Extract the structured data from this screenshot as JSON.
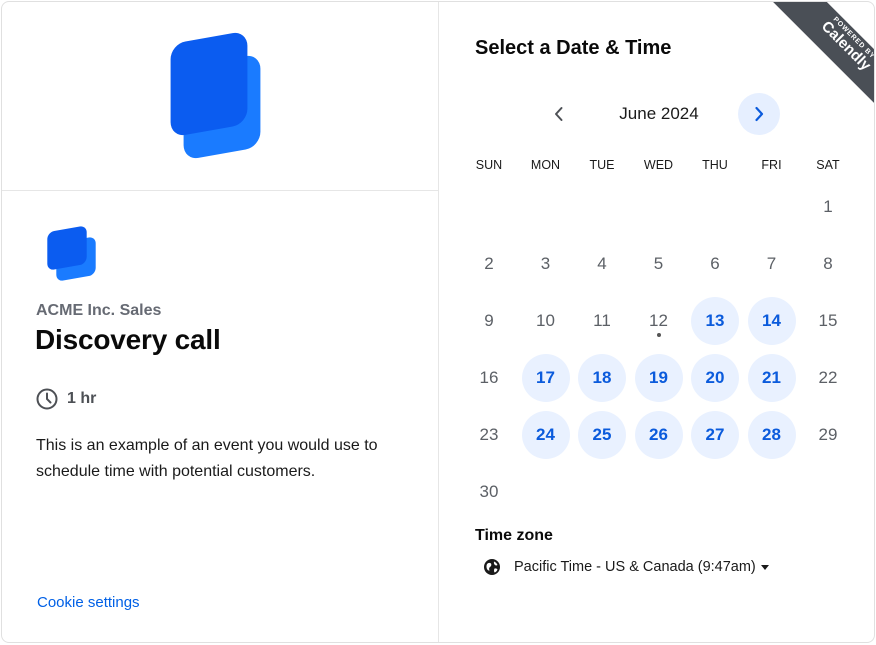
{
  "brand": {
    "logo_colors": {
      "back": "#1a7bff",
      "front": "#0b5cf0"
    }
  },
  "event": {
    "organization": "ACME Inc. Sales",
    "title": "Discovery call",
    "duration": "1 hr",
    "description": "This is an example of an event you would use to schedule time with potential customers."
  },
  "footer": {
    "cookie_settings": "Cookie settings"
  },
  "scheduler": {
    "heading": "Select a Date & Time",
    "badge": {
      "small": "POWERED BY",
      "brand": "Calendly"
    },
    "month": "June 2024",
    "weekdays": [
      "SUN",
      "MON",
      "TUE",
      "WED",
      "THU",
      "FRI",
      "SAT"
    ],
    "first_weekday_index": 6,
    "days_in_month": 30,
    "today": 12,
    "available_days": [
      13,
      14,
      17,
      18,
      19,
      20,
      21,
      24,
      25,
      26,
      27,
      28
    ],
    "timezone_label": "Time zone",
    "timezone_value": "Pacific Time - US & Canada (9:47am)",
    "colors": {
      "accent": "#0b5bdc",
      "available_bg": "#e9f1ff"
    }
  }
}
